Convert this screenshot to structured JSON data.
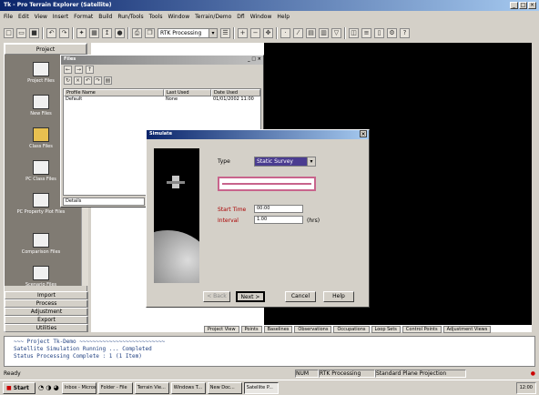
{
  "titlebar": {
    "title": "Tk - Pro Terrain Explorer (Satellite)"
  },
  "menu": [
    "File",
    "Edit",
    "View",
    "Insert",
    "Format",
    "Build",
    "Run/Tools",
    "Tools",
    "Window",
    "Terrain/Demo",
    "Dfl",
    "Window",
    "Help"
  ],
  "toolbar": {
    "combo_value": "RTK Processing"
  },
  "sidebar": {
    "header": "Project",
    "items": [
      "Project Files",
      "New Files",
      "Class Files",
      "PC Class Files",
      "PC Property Plot Files",
      "Comparison Files",
      "Scenario Files"
    ],
    "bottom": [
      "Import",
      "Process",
      "Adjustment",
      "Export",
      "Utilities"
    ]
  },
  "filewindow": {
    "title": "Files",
    "columns": [
      "Profile Name",
      "Last Used",
      "Date Used"
    ],
    "row": {
      "name": "Default",
      "used": "None",
      "date": "01/01/2002 11:00"
    },
    "footer": "Details"
  },
  "dialog": {
    "title": "Simulate",
    "type_label": "Type",
    "type_value": "Static Survey",
    "start_label": "Start Time",
    "start_value": "00:00",
    "interval_label": "Interval",
    "interval_value": "1.00",
    "interval_unit": "(hrs)",
    "back": "< Back",
    "next": "Next >",
    "cancel": "Cancel",
    "help": "Help"
  },
  "tabs": [
    "Project View",
    "Points",
    "Baselines",
    "Observations",
    "Occupations",
    "Loop Sets",
    "Control Points",
    "Adjustment Views"
  ],
  "output": [
    "~~~ Project Tk-Demo ~~~~~~~~~~~~~~~~~~~~~~~~~~",
    "Satellite Simulation Running ... Completed",
    "Status Processing Complete : 1 (1 Item)"
  ],
  "status": {
    "left": "Ready",
    "mid1": "NUM",
    "mid2": "RTK Processing",
    "mid3": "Standard Plane Projection"
  },
  "taskbar": {
    "start": "Start",
    "tasks": [
      "Inbox - Microsoft",
      "Folder - File",
      "Terrain Vie...",
      "Windows T...",
      "New Doc...",
      "Satellite P..."
    ],
    "clock": "12:00"
  }
}
